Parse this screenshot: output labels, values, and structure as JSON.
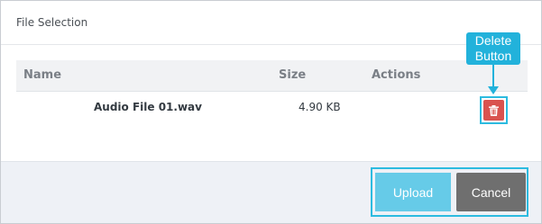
{
  "dialog": {
    "title": "File Selection"
  },
  "table": {
    "columns": {
      "name": "Name",
      "size": "Size",
      "actions": "Actions"
    },
    "rows": [
      {
        "name": "Audio File 01.wav",
        "size": "4.90 KB",
        "action_icon": "trash-icon"
      }
    ]
  },
  "annotation": {
    "line1": "Delete",
    "line2": "Button"
  },
  "footer": {
    "upload_label": "Upload",
    "cancel_label": "Cancel"
  },
  "colors": {
    "accent": "#22b2db",
    "delete": "#d9534f",
    "upload": "#66cbe8",
    "cancel": "#6f6f6f"
  }
}
